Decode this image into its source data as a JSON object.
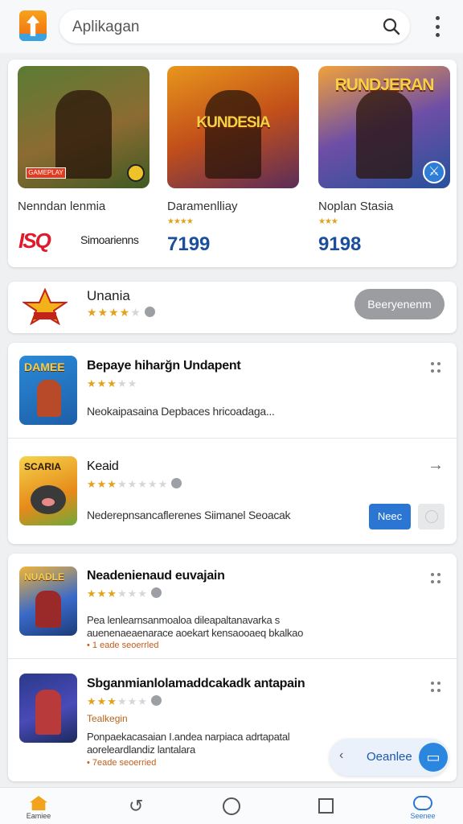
{
  "header": {
    "search_placeholder": "Aplikagan",
    "logo_icon": "app-logo-icon",
    "search_icon": "search-icon",
    "menu_icon": "more-vert-icon"
  },
  "featured": {
    "items": [
      {
        "name": "Nenndan lenmia",
        "stars": "★★★★★",
        "thumb_badge": "GAMEPLAY",
        "thumb_title": ""
      },
      {
        "name": "Daramenlliay",
        "stars": "★★★★",
        "price": "7199",
        "thumb_title": "KUNDESIA"
      },
      {
        "name": "Noplan Stasia",
        "stars": "★★★",
        "price": "9198",
        "thumb_title": "RUNDJERAN"
      }
    ],
    "brand_logo": "ISQ",
    "brand_label": "Simoarienns"
  },
  "developer": {
    "title": "Unania",
    "stars_full": "★★★★",
    "stars_empty": "★",
    "button_label": "Beeryenenm",
    "logo_text": "A"
  },
  "list_a": [
    {
      "title": "Bepaye hiharğn Undapent",
      "stars_full": "★★★",
      "stars_empty": "★★",
      "desc": "Neokaipasaina Depbaces hricoadaga...",
      "icon_title": "DAMEE"
    },
    {
      "title": "Keaid",
      "stars_full": "★★★",
      "stars_empty": "★★★★★",
      "desc": "Nederepnsancaflerenes Siimanel Seoacak",
      "icon_title": "SCARIA",
      "action_label": "Neec"
    }
  ],
  "list_b": [
    {
      "title": "Neadenienaud euvajain",
      "stars_full": "★★★",
      "stars_empty": "★★★",
      "desc_line1": "Pea lenlearnsanmoaloa dileapaltanavarka s",
      "desc_line2": "auenenaeaenarace aoekart kensaooaeq bkalkao",
      "tag": "• 1 eade seoerrled",
      "icon_title": "NUADLE"
    },
    {
      "title": "Sbganmianlolamaddcakadk antapain",
      "stars_full": "★★★",
      "stars_empty": "★★★",
      "tag_line": "Tealkegin",
      "desc_line1": "Ponpaekacasaian I.andea narpiaca adrtapatal",
      "desc_line2": "aoreleardlandiz lantalara",
      "tag": "• 7eade seoerried",
      "icon_title": ""
    }
  ],
  "floating": {
    "label": "Oeanlee",
    "button_icon": "open-icon"
  },
  "bottom_nav": {
    "home_label": "Eamiee",
    "chat_label": "Seenee"
  },
  "colors": {
    "accent": "#2a76d2",
    "star": "#e3a21b",
    "price": "#1b4f9e",
    "brand_red": "#e0192b"
  }
}
